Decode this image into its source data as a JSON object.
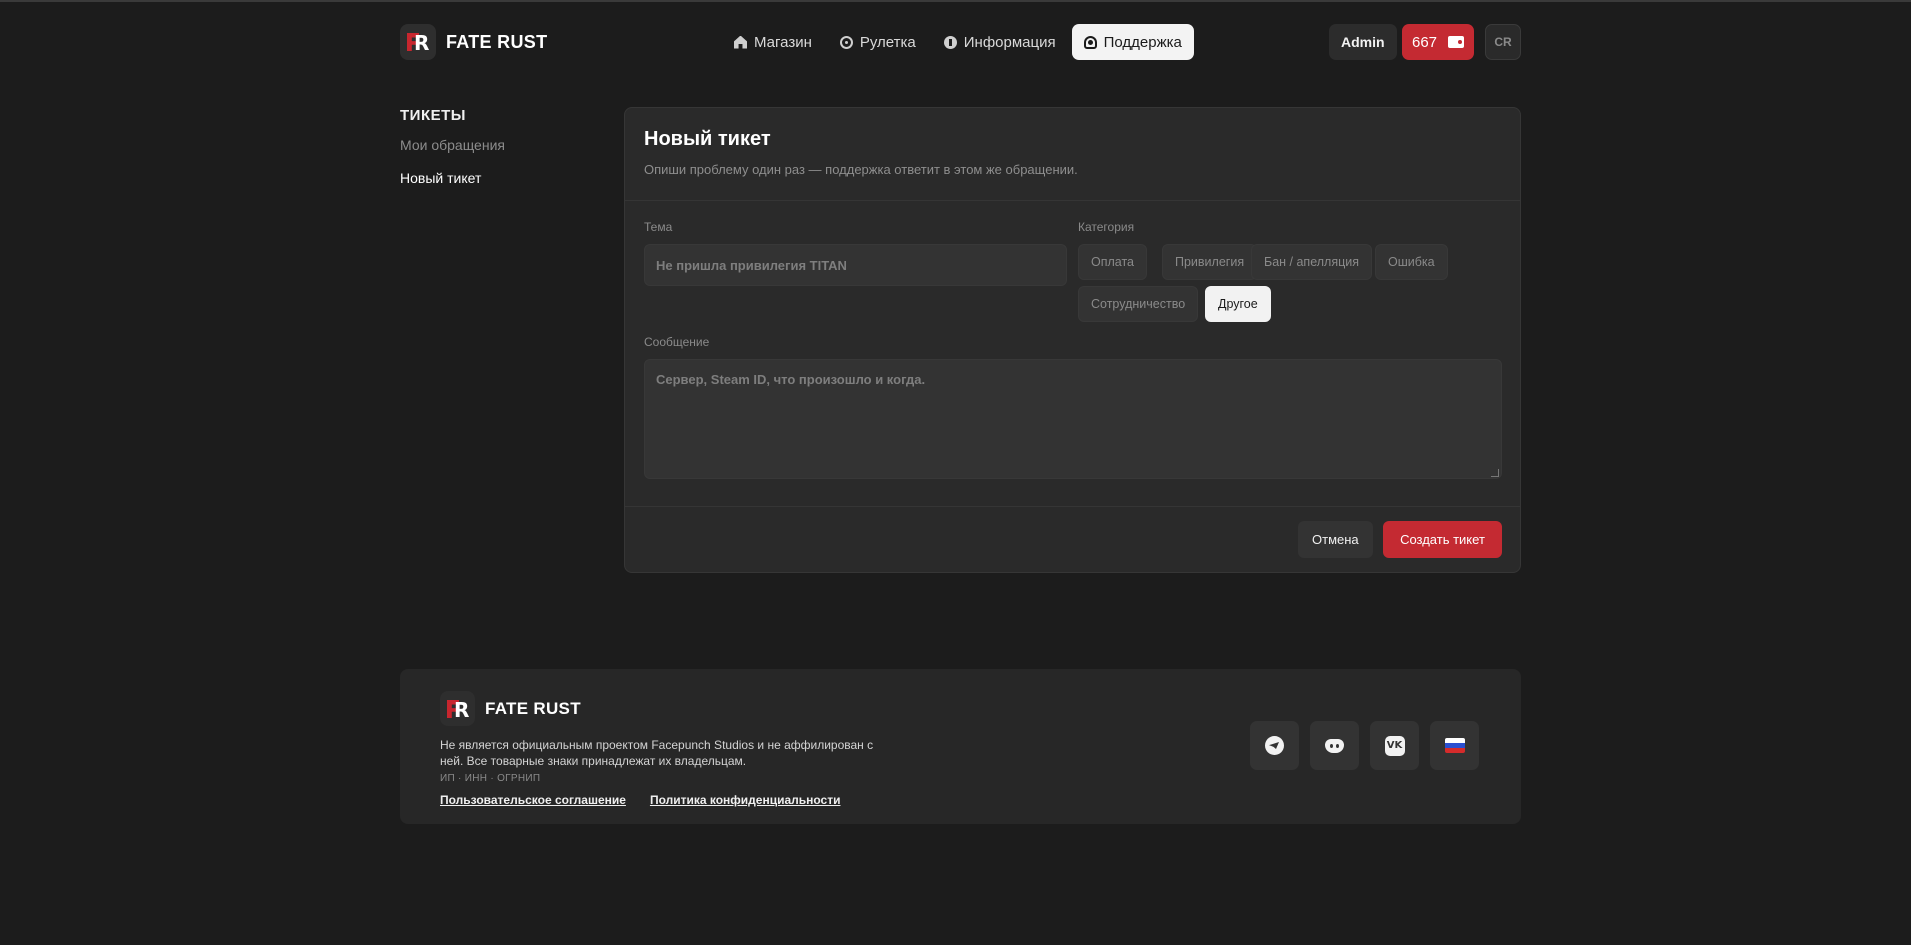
{
  "brand": {
    "name": "FATE RUST"
  },
  "nav": {
    "items": [
      {
        "label": "Магазин",
        "icon": "home-icon"
      },
      {
        "label": "Рулетка",
        "icon": "wheel-icon"
      },
      {
        "label": "Информация",
        "icon": "info-icon"
      },
      {
        "label": "Поддержка",
        "icon": "support-icon",
        "active": true
      }
    ]
  },
  "user": {
    "role": "Admin",
    "balance": "667",
    "avatar_text": "CR"
  },
  "sidebar": {
    "title": "ТИКЕТЫ",
    "items": [
      {
        "label": "Мои обращения"
      },
      {
        "label": "Новый тикет",
        "active": true
      }
    ]
  },
  "ticket_form": {
    "title": "Новый тикет",
    "subtitle": "Опиши проблему один раз — поддержка ответит в этом же обращении.",
    "topic_label": "Тема",
    "topic_placeholder": "Не пришла привилегия TITAN",
    "category_label": "Категория",
    "categories": [
      "Оплата",
      "Привилегия",
      "Бан / апелляция",
      "Ошибка",
      "Сотрудничество",
      "Другое"
    ],
    "selected_category": "Другое",
    "message_label": "Сообщение",
    "message_placeholder": "Сервер, Steam ID, что произошло и когда.",
    "cancel_label": "Отмена",
    "submit_label": "Создать тикет"
  },
  "footer": {
    "brand": "FATE RUST",
    "disclaimer": "Не является официальным проектом Facepunch Studios и не аффилирован с ней. Все товарные знаки принадлежат их владельцам.",
    "legal": "ИП · ИНН · ОГРНИП",
    "links": [
      "Пользовательское соглашение",
      "Политика конфиденциальности"
    ],
    "socials": [
      "telegram-icon",
      "discord-icon",
      "vk-icon",
      "language-flag-icon"
    ]
  },
  "colors": {
    "accent": "#c42a32",
    "background": "#1c1c1c",
    "card": "#2a2a2a"
  }
}
